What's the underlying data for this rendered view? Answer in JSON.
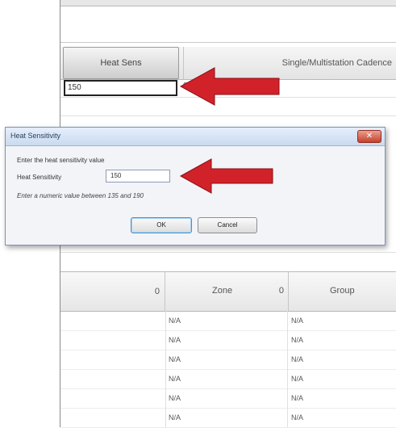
{
  "grid": {
    "columns_top": {
      "heat_sens": "Heat Sens",
      "cadence": "Single/Multistation Cadence"
    },
    "edit_cell_value": "150",
    "adjacent_cell_value": "0",
    "lower_header": {
      "col1_indicator": "0",
      "zone": "Zone",
      "zone_indicator": "0",
      "group": "Group"
    },
    "rows": [
      {
        "zone": "N/A",
        "group": "N/A"
      },
      {
        "zone": "N/A",
        "group": "N/A"
      },
      {
        "zone": "N/A",
        "group": "N/A"
      },
      {
        "zone": "N/A",
        "group": "N/A"
      },
      {
        "zone": "N/A",
        "group": "N/A"
      },
      {
        "zone": "N/A",
        "group": "N/A"
      }
    ]
  },
  "dialog": {
    "title": "Heat Sensitivity",
    "close_symbol": "✕",
    "prompt": "Enter the heat sensitivity value",
    "field_label": "Heat Sensitivity",
    "field_value": "150",
    "hint": "Enter a numeric value between 135 and 190",
    "ok_label": "OK",
    "cancel_label": "Cancel"
  },
  "annotations": {
    "arrow_color": "#d1222a"
  }
}
